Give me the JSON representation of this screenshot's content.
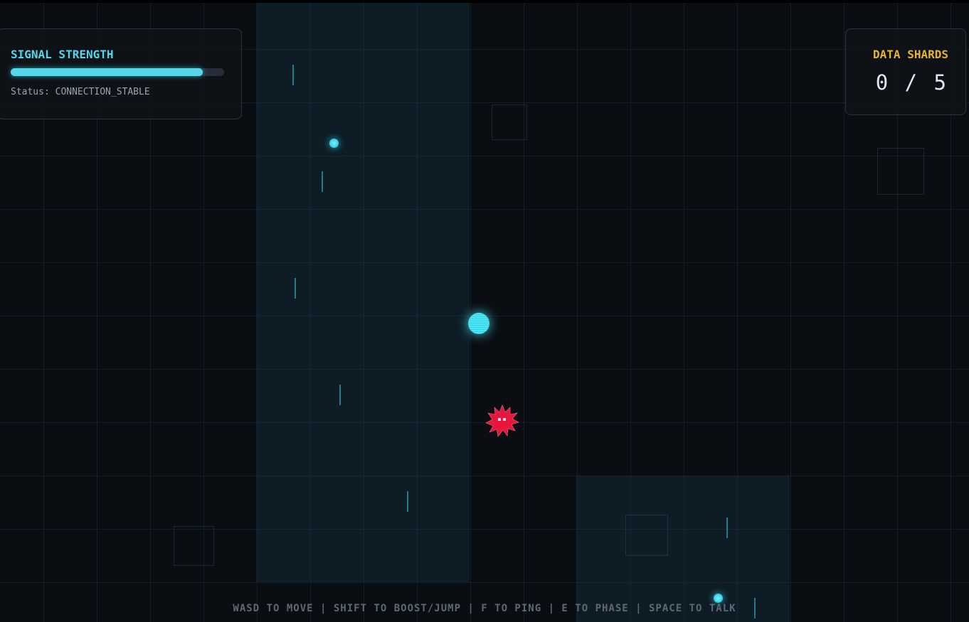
{
  "hud": {
    "signal": {
      "title": "SIGNAL STRENGTH",
      "level": 0.9,
      "status": "Status: CONNECTION_STABLE",
      "color": "#3ad6ef"
    },
    "shards": {
      "title": "DATA SHARDS",
      "collected": 0,
      "total": 5,
      "display": "0 / 5",
      "color": "#e8b42a"
    }
  },
  "controls_hint": "WASD TO MOVE | SHIFT TO BOOST/JUMP | F TO PING | E TO PHASE | SPACE TO TALK",
  "colors": {
    "background": "#0a0d12",
    "player": "#3ad6ef",
    "enemy": "#e8153c",
    "node": "#39d2ea"
  },
  "icons": {
    "player": "signal-orb",
    "enemy": "spiky-virus",
    "node": "data-node"
  }
}
